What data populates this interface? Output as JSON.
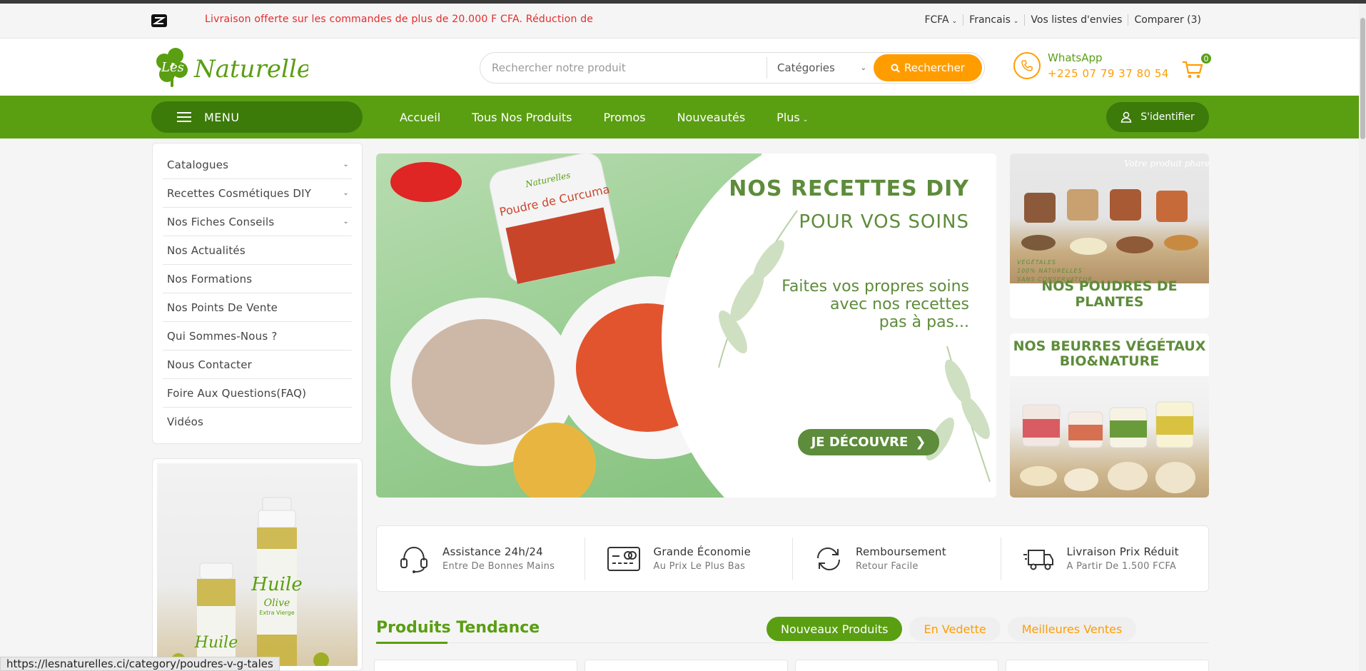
{
  "topbar": {
    "promo": "Livraison offerte sur les commandes de plus de 20.000 F CFA. Réduction de",
    "currency": "FCFA",
    "language": "Francais",
    "wishlist": "Vos listes d'envies",
    "compare": "Comparer (3)"
  },
  "header": {
    "search_placeholder": "Rechercher notre produit",
    "category_select": "Catégories",
    "search_button": "Rechercher",
    "whatsapp_label": "WhatsApp",
    "phone": "+225 07 79 37 80 54",
    "cart_count": "0"
  },
  "nav": {
    "menu_label": "MENU",
    "links": [
      "Accueil",
      "Tous Nos Produits",
      "Promos",
      "Nouveautés",
      "Plus"
    ],
    "login": "S'identifier"
  },
  "sidebar": {
    "items": [
      {
        "label": "Catalogues",
        "has_submenu": true
      },
      {
        "label": "Recettes Cosmétiques DIY",
        "has_submenu": true
      },
      {
        "label": "Nos Fiches Conseils",
        "has_submenu": true
      },
      {
        "label": "Nos Actualités",
        "has_submenu": false
      },
      {
        "label": "Nos Formations",
        "has_submenu": false
      },
      {
        "label": "Nos Points De Vente",
        "has_submenu": false
      },
      {
        "label": "Qui Sommes-Nous ?",
        "has_submenu": false
      },
      {
        "label": "Nous Contacter",
        "has_submenu": false
      },
      {
        "label": "Foire Aux Questions(FAQ)",
        "has_submenu": false
      },
      {
        "label": "Vidéos",
        "has_submenu": false
      }
    ]
  },
  "hero": {
    "title": "NOS RECETTES DIY",
    "subtitle": "POUR VOS SOINS",
    "description": "Faites vos propres soins\navec nos recettes\npas à pas...",
    "cta": "JE DÉCOUVRE",
    "jar_brand": "Naturelles",
    "jar_label": "Poudre de Curcuma"
  },
  "promos": {
    "card1_title": "NOS POUDRES DE PLANTES",
    "card1_tags": [
      "VÉGÉTALES",
      "100% NATURELLES",
      "SANS CONSERVATEUR"
    ],
    "card1_handwritten": "Votre produit phare",
    "card2_title": "NOS BEURRES VÉGÉTAUX BIO&NATURE"
  },
  "features": [
    {
      "title": "Assistance 24h/24",
      "subtitle": "Entre De Bonnes Mains",
      "icon": "headset-icon"
    },
    {
      "title": "Grande Économie",
      "subtitle": "Au Prix Le Plus Bas",
      "icon": "card-icon"
    },
    {
      "title": "Remboursement",
      "subtitle": "Retour Facile",
      "icon": "refresh-icon"
    },
    {
      "title": "Livraison Prix Réduit",
      "subtitle": "A Partir De 1.500 FCFA",
      "icon": "truck-icon"
    }
  ],
  "trending": {
    "title": "Produits Tendance",
    "tabs": [
      "Nouveaux Produits",
      "En Vedette",
      "Meilleures Ventes"
    ],
    "active_tab": "Nouveaux Produits"
  },
  "side_banner": {
    "bottle_label_1": "Huile",
    "bottle_label_2": "Olive",
    "bottle_label_3": "Extra Vierge",
    "bottle_label_small": "Huile"
  },
  "status_url": "https://lesnaturelles.ci/category/poudres-v-g-tales",
  "colors": {
    "brand_green": "#5a9e12",
    "dark_green": "#3c7a0a",
    "accent_orange": "#ff9d00",
    "promo_red": "#e62b2b"
  }
}
